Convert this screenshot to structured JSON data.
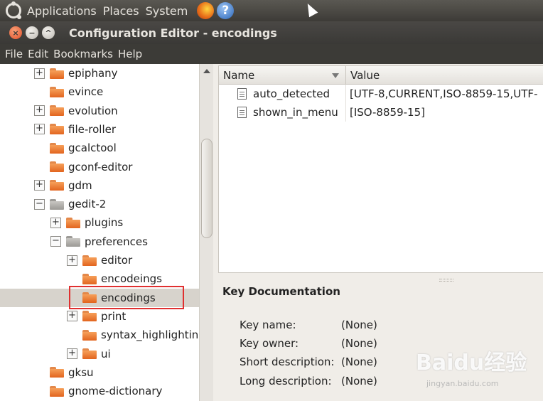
{
  "panel": {
    "menus": [
      "Applications",
      "Places",
      "System"
    ]
  },
  "window": {
    "title": "Configuration Editor - encodings"
  },
  "menubar": [
    "File",
    "Edit",
    "Bookmarks",
    "Help"
  ],
  "tree": [
    {
      "label": "epiphany",
      "expander": "+",
      "level": 0,
      "icon": "orange"
    },
    {
      "label": "evince",
      "expander": "",
      "level": 0,
      "icon": "orange"
    },
    {
      "label": "evolution",
      "expander": "+",
      "level": 0,
      "icon": "orange"
    },
    {
      "label": "file-roller",
      "expander": "+",
      "level": 0,
      "icon": "orange"
    },
    {
      "label": "gcalctool",
      "expander": "",
      "level": 0,
      "icon": "orange"
    },
    {
      "label": "gconf-editor",
      "expander": "",
      "level": 0,
      "icon": "orange"
    },
    {
      "label": "gdm",
      "expander": "+",
      "level": 0,
      "icon": "orange"
    },
    {
      "label": "gedit-2",
      "expander": "−",
      "level": 0,
      "icon": "gray"
    },
    {
      "label": "plugins",
      "expander": "+",
      "level": 1,
      "icon": "orange"
    },
    {
      "label": "preferences",
      "expander": "−",
      "level": 1,
      "icon": "gray"
    },
    {
      "label": "editor",
      "expander": "+",
      "level": 2,
      "icon": "orange"
    },
    {
      "label": "encodeings",
      "expander": "",
      "level": 2,
      "icon": "orange"
    },
    {
      "label": "encodings",
      "expander": "",
      "level": 2,
      "icon": "orange",
      "selected": true
    },
    {
      "label": "print",
      "expander": "+",
      "level": 2,
      "icon": "orange"
    },
    {
      "label": "syntax_highlighting",
      "expander": "",
      "level": 2,
      "icon": "orange"
    },
    {
      "label": "ui",
      "expander": "+",
      "level": 2,
      "icon": "orange"
    },
    {
      "label": "gksu",
      "expander": "",
      "level": 0,
      "icon": "orange"
    },
    {
      "label": "gnome-dictionary",
      "expander": "",
      "level": 0,
      "icon": "orange"
    }
  ],
  "list": {
    "col_name": "Name",
    "col_value": "Value",
    "rows": [
      {
        "name": "auto_detected",
        "value": "[UTF-8,CURRENT,ISO-8859-15,UTF-"
      },
      {
        "name": "shown_in_menu",
        "value": "[ISO-8859-15]"
      }
    ]
  },
  "doc": {
    "title": "Key Documentation",
    "items": [
      {
        "key": "Key name:",
        "value": "(None)"
      },
      {
        "key": "Key owner:",
        "value": "(None)"
      },
      {
        "key": "Short description:",
        "value": "(None)"
      },
      {
        "key": "Long description:",
        "value": "(None)"
      }
    ]
  },
  "watermark": {
    "main": "Baidu经验",
    "sub": "jingyan.baidu.com"
  }
}
